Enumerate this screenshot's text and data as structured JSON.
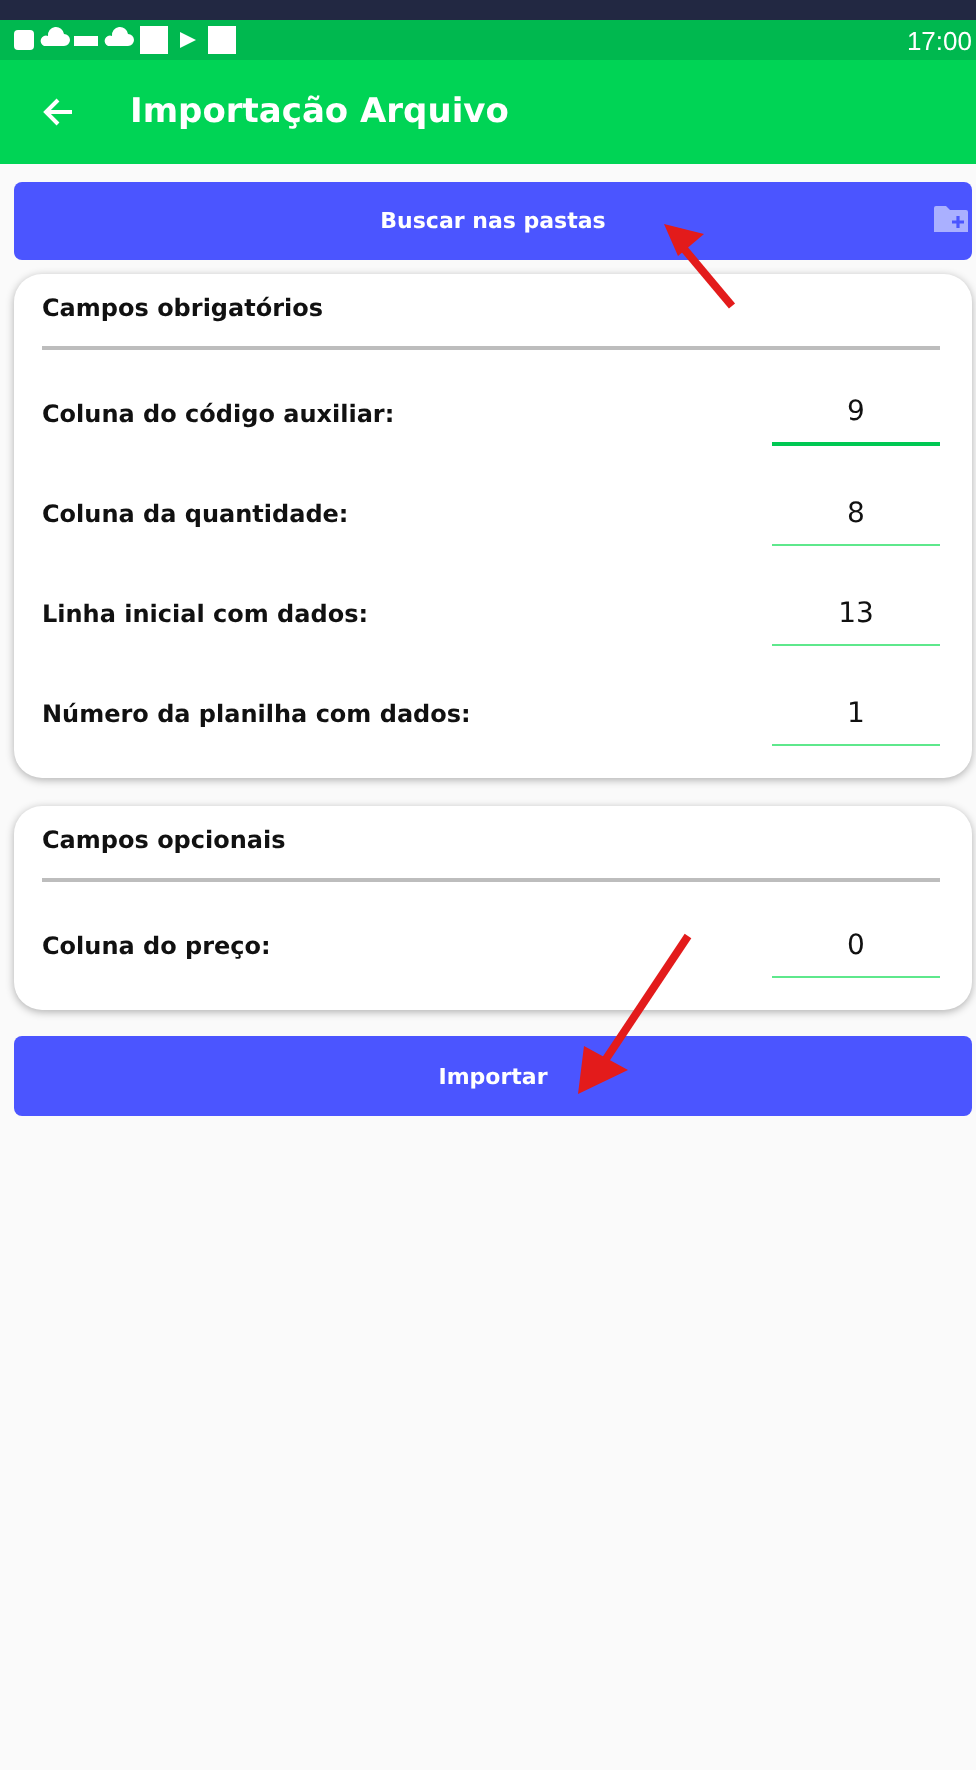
{
  "status_bar": {
    "time": "17:00"
  },
  "app_bar": {
    "title": "Importação Arquivo"
  },
  "browse_button": {
    "label": "Buscar nas pastas"
  },
  "sections": [
    {
      "title": "Campos obrigatórios",
      "fields": [
        {
          "label": "Coluna do código auxiliar:",
          "value": "9",
          "focused": true
        },
        {
          "label": "Coluna da quantidade:",
          "value": "8",
          "focused": false
        },
        {
          "label": "Linha inicial com dados:",
          "value": "13",
          "focused": false
        },
        {
          "label": "Número da planilha com dados:",
          "value": "1",
          "focused": false
        }
      ]
    },
    {
      "title": "Campos opcionais",
      "fields": [
        {
          "label": "Coluna do preço:",
          "value": "0",
          "focused": false
        }
      ]
    }
  ],
  "import_button": {
    "label": "Importar"
  }
}
